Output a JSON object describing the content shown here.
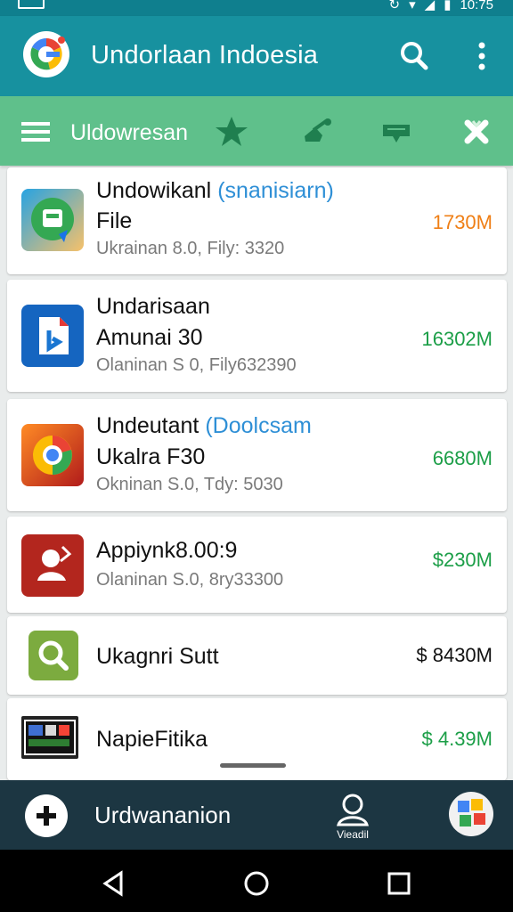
{
  "status_bar": {
    "time": "10:75",
    "colors": {
      "background": "#0f7f8e"
    }
  },
  "app_bar": {
    "title": "Undorlaan Indoesia",
    "icons": [
      "app-logo",
      "search-icon",
      "more-icon"
    ],
    "color": "#17919f"
  },
  "tab_bar": {
    "label": "Uldowresan",
    "icons": [
      "menu-icon",
      "star-icon",
      "share-icon",
      "message-icon",
      "tools-icon"
    ],
    "color": "#5fc08b"
  },
  "items": [
    {
      "line1": "Undowikanl",
      "line1_accent": "(snanisiarn)",
      "line2": "File",
      "subtitle": "Ukrainan 8.0, Fily: 3320",
      "size": "1730M",
      "size_color": "#ef7f16",
      "icon": "chat-icon"
    },
    {
      "line1": "Undarisaan",
      "line2": "Amunai 30",
      "subtitle": "Olaninan S 0, Fily632390",
      "size": "16302M",
      "size_color": "#1b9e47",
      "icon": "file-icon"
    },
    {
      "line1": "Undeutant",
      "line1_accent": "(Doolcsam",
      "line2": "Ukalra F30",
      "subtitle": "Okninan S.0, Tdy: 5030",
      "size": "6680M",
      "size_color": "#1b9e47",
      "icon": "chrome-icon"
    },
    {
      "line1": "Appiynk8.00:9",
      "subtitle": "Olaninan S.0, 8ry33300",
      "size": "$230M",
      "size_color": "#1b9e47",
      "icon": "person-icon"
    },
    {
      "line1": "Ukagnri Sutt",
      "size": "$ 8430M",
      "size_color": "#111111",
      "icon": "search-app-icon"
    },
    {
      "line1": "NapieFitika",
      "size": "$ 4.39M",
      "size_color": "#1b9e47",
      "icon": "media-icon"
    }
  ],
  "bottom_bar": {
    "label": "Urdwananion",
    "profile_label": "Vieadil",
    "icons": [
      "add-icon",
      "profile-icon",
      "avatar-icon"
    ]
  },
  "nav_bar": {
    "icons": [
      "back-icon",
      "home-icon",
      "recents-icon"
    ]
  }
}
